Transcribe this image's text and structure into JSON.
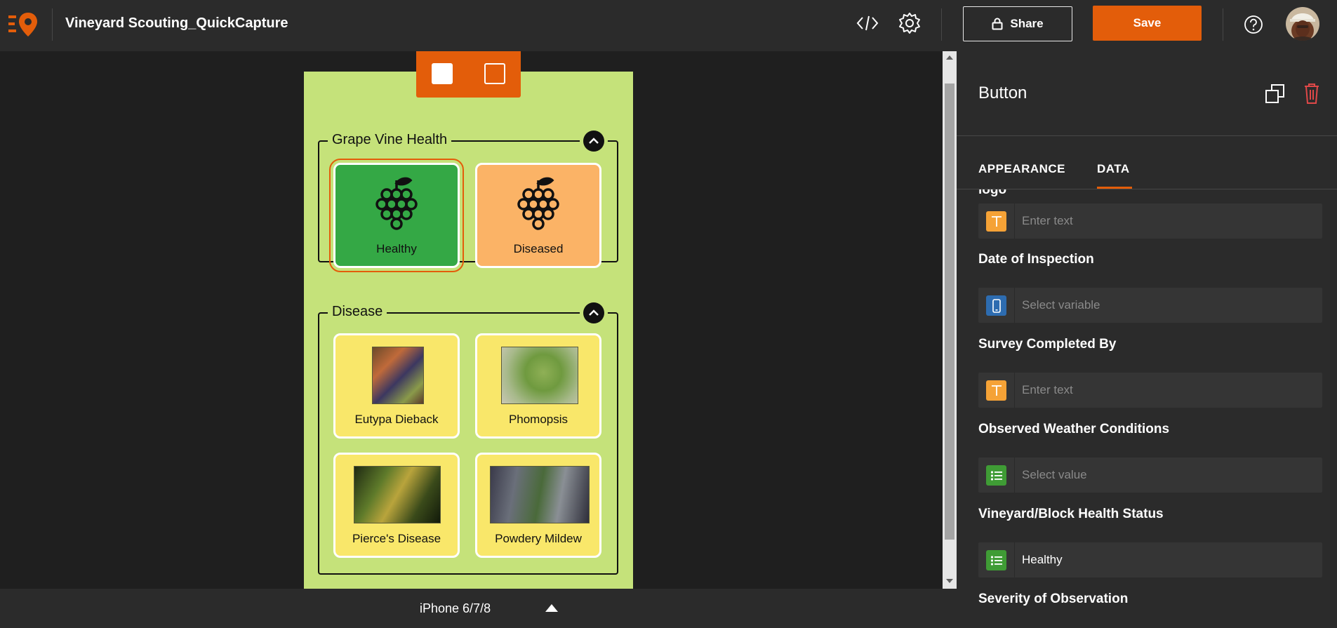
{
  "header": {
    "app_title": "Vineyard Scouting_QuickCapture",
    "share_label": "Share",
    "save_label": "Save"
  },
  "colors": {
    "accent": "#e35d0a",
    "healthy": "#34a845",
    "diseased": "#fbb366",
    "disease_tile": "#f9e76a",
    "phone_bg": "#c5e27a"
  },
  "phone": {
    "groups": [
      {
        "title": "Grape Vine Health",
        "buttons": [
          {
            "label": "Healthy"
          },
          {
            "label": "Diseased"
          }
        ]
      },
      {
        "title": "Disease",
        "buttons": [
          {
            "label": "Eutypa Dieback"
          },
          {
            "label": "Phomopsis"
          },
          {
            "label": "Pierce's Disease"
          },
          {
            "label": "Powdery Mildew"
          }
        ]
      }
    ]
  },
  "device": {
    "name": "iPhone 6/7/8"
  },
  "panel": {
    "title": "Button",
    "tabs": [
      {
        "label": "APPEARANCE"
      },
      {
        "label": "DATA"
      }
    ],
    "fields": [
      {
        "label": "logo",
        "value": "",
        "placeholder": "Enter text",
        "icon": "text-icon"
      },
      {
        "label": "Date of Inspection",
        "value": "",
        "placeholder": "Select variable",
        "icon": "phone-variable-icon"
      },
      {
        "label": "Survey Completed By",
        "value": "",
        "placeholder": "Enter text",
        "icon": "text-icon"
      },
      {
        "label": "Observed Weather Conditions",
        "value": "",
        "placeholder": "Select value",
        "icon": "list-icon"
      },
      {
        "label": "Vineyard/Block Health Status",
        "value": "Healthy",
        "placeholder": "",
        "icon": "list-icon"
      },
      {
        "label": "Severity of Observation"
      }
    ]
  }
}
